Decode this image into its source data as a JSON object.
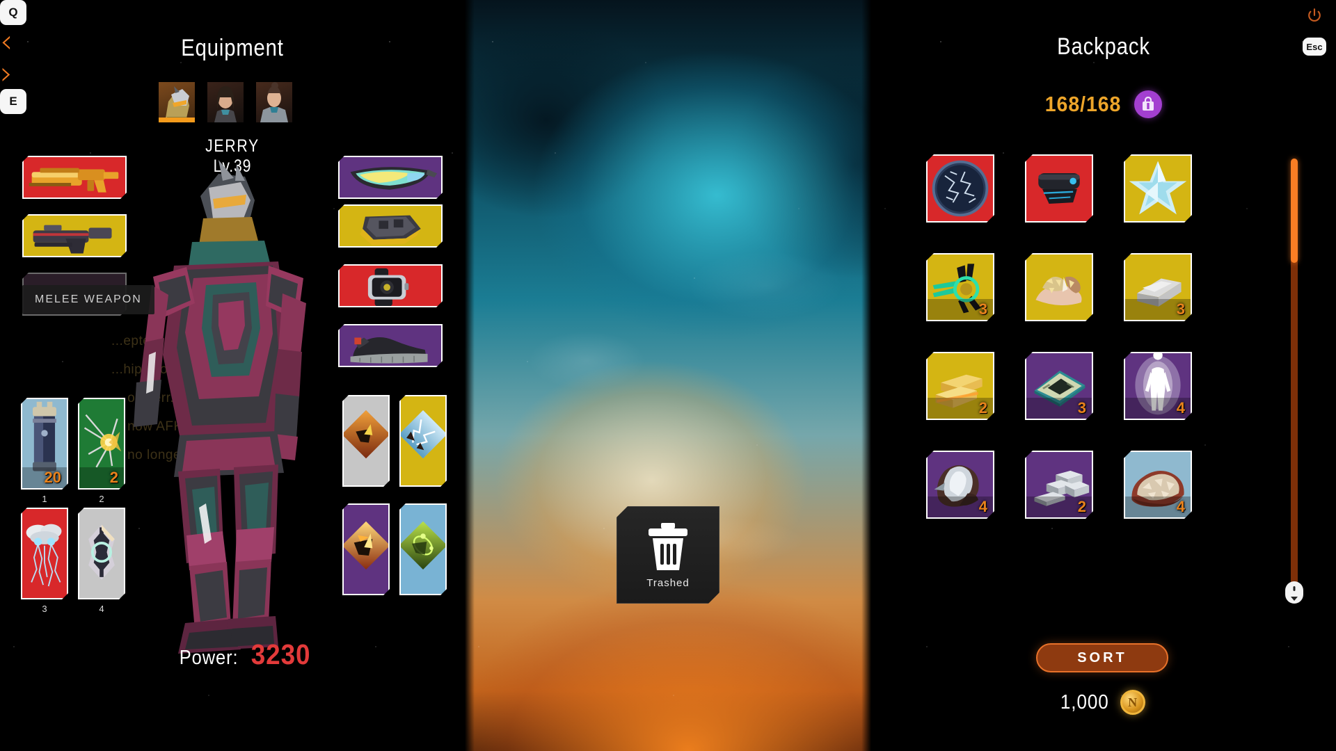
{
  "window": {
    "title": "Equipment & Backpack"
  },
  "topbar": {
    "power_icon": "power-icon",
    "esc_key": "Esc"
  },
  "equipment": {
    "title": "Equipment",
    "prev_key": "Q",
    "next_key": "E",
    "prev_arrow": "‹",
    "next_arrow": "›",
    "character": {
      "name": "JERRY",
      "level": "Lv.39"
    },
    "portraits": [
      {
        "name": "rhino-helm-portrait",
        "selected": true
      },
      {
        "name": "female-pilot-portrait",
        "selected": false
      },
      {
        "name": "armored-woman-portrait",
        "selected": false
      }
    ],
    "tooltip": "MELEE WEAPON",
    "power_label": "Power:",
    "power_value": "3230",
    "left_slots": [
      {
        "name": "primary-weapon-slot",
        "rarity": "red",
        "icon": "gold-assault-rifle"
      },
      {
        "name": "secondary-weapon-slot",
        "rarity": "gold",
        "icon": "dark-pistol"
      },
      {
        "name": "melee-weapon-slot",
        "rarity": "none",
        "icon": "melee-blade"
      }
    ],
    "right_slots": [
      {
        "name": "eyewear-slot",
        "rarity": "purple",
        "icon": "visor-glasses"
      },
      {
        "name": "headgear-slot",
        "rarity": "gold",
        "icon": "helmet-plate"
      },
      {
        "name": "wrist-slot",
        "rarity": "red",
        "icon": "smart-watch"
      },
      {
        "name": "footwear-slot",
        "rarity": "purple",
        "icon": "sneaker-boot"
      }
    ],
    "consumables": [
      {
        "name": "consumable-slot-1",
        "rarity": "ltblue",
        "icon": "grenade-canister",
        "qty": "20",
        "key": "1"
      },
      {
        "name": "consumable-slot-2",
        "rarity": "green",
        "icon": "spike-burst",
        "qty": "2",
        "key": "2"
      },
      {
        "name": "consumable-slot-3",
        "rarity": "red",
        "icon": "lightning-cloud",
        "qty": "",
        "key": "3"
      },
      {
        "name": "consumable-slot-4",
        "rarity": "grey",
        "icon": "shield-core",
        "qty": "",
        "key": "4"
      }
    ],
    "mods": [
      {
        "name": "mod-slot-1",
        "rarity": "grey",
        "icon": "fire-strike-mod"
      },
      {
        "name": "mod-slot-2",
        "rarity": "gold",
        "icon": "lightning-mod"
      },
      {
        "name": "mod-slot-3",
        "rarity": "purple",
        "icon": "flame-blade-mod"
      },
      {
        "name": "mod-slot-4",
        "rarity": "blue",
        "icon": "toxic-mod"
      }
    ],
    "ghost_chat": [
      "...epted:  ...",
      "...hips sold C...x24...",
      "... on Terr...",
      "... now AFK",
      "... no longer"
    ]
  },
  "trash": {
    "label": "Trashed",
    "icon": "trash-can-icon"
  },
  "backpack": {
    "title": "Backpack",
    "capacity": "168/168",
    "bag_icon": "backpack-icon",
    "sort_label": "SORT",
    "currency": "1,000",
    "coin_icon": "gold-coin-icon",
    "scroll_icon": "mouse-scroll-icon",
    "items": [
      {
        "name": "item-frozen-disc",
        "rarity": "red",
        "icon": "frozen-disc",
        "qty": ""
      },
      {
        "name": "item-scope-module",
        "rarity": "red",
        "icon": "scope-module",
        "qty": ""
      },
      {
        "name": "item-ice-crystal",
        "rarity": "gold",
        "icon": "ice-star-crystal",
        "qty": ""
      },
      {
        "name": "item-alien-relic",
        "rarity": "gold",
        "icon": "alien-ring-relic",
        "qty": "3"
      },
      {
        "name": "item-gold-ore",
        "rarity": "gold",
        "icon": "gold-ore-rock",
        "qty": ""
      },
      {
        "name": "item-steel-ingot",
        "rarity": "gold",
        "icon": "steel-ingot",
        "qty": "3"
      },
      {
        "name": "item-gold-bars",
        "rarity": "gold",
        "icon": "gold-bars",
        "qty": "2"
      },
      {
        "name": "item-cpu-chip",
        "rarity": "purple",
        "icon": "cpu-chip",
        "qty": "3"
      },
      {
        "name": "item-clone-figure",
        "rarity": "purple",
        "icon": "glowing-humanoid",
        "qty": "4"
      },
      {
        "name": "item-quartz-rock",
        "rarity": "purple",
        "icon": "quartz-rock",
        "qty": "4"
      },
      {
        "name": "item-silver-bars",
        "rarity": "purple",
        "icon": "silver-bars",
        "qty": "2"
      },
      {
        "name": "item-copper-ore",
        "rarity": "ltblue",
        "icon": "copper-ore-rock",
        "qty": "4"
      }
    ]
  },
  "colors": {
    "accent": "#f07a22",
    "rarity_red": "#d8282a",
    "rarity_gold": "#d4b513",
    "rarity_purple": "#5f3380",
    "rarity_blue": "#79b3d4",
    "rarity_grey": "#c6c6c6",
    "power_value": "#e23a3a",
    "capacity": "#eda52a"
  }
}
